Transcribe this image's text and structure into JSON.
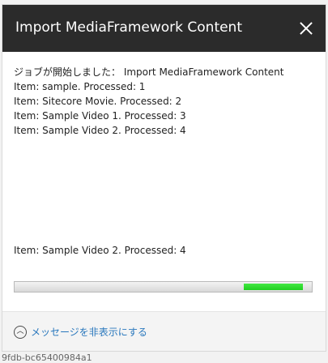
{
  "background": {
    "partial_id_text": "9fdb-bc65400984a1"
  },
  "dialog": {
    "title": "Import MediaFramework Content",
    "close_icon": "close-icon",
    "messages": [
      "ジョブが開始しました： Import MediaFramework Content",
      "Item: sample. Processed: 1",
      "Item: Sitecore Movie. Processed: 2",
      "Item: Sample Video 1. Processed: 3",
      "Item: Sample Video 2. Processed: 4"
    ],
    "latest_message": "Item: Sample Video 2. Processed: 4",
    "progress": {
      "segment_start_fraction": 0.77,
      "segment_end_fraction": 0.97,
      "color": "#1fcf1f"
    },
    "footer": {
      "icon": "chevron-up-icon",
      "label": "メッセージを非表示にする",
      "link_color": "#2a78bd"
    }
  }
}
